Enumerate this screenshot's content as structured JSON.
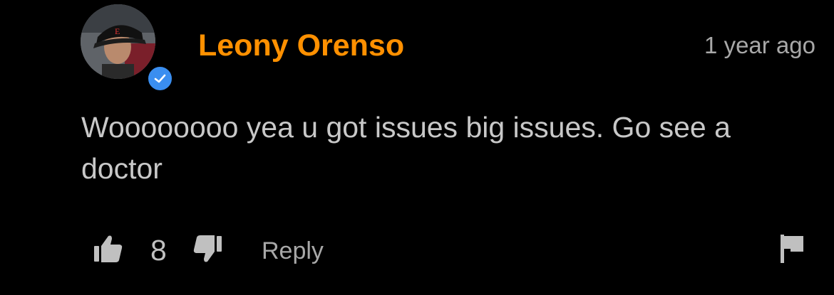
{
  "comment": {
    "author": "Leony Orenso",
    "timestamp": "1 year ago",
    "text": "Woooooooo yea u got issues big issues. Go see a doctor",
    "verified": true,
    "likes": "8",
    "reply_label": "Reply",
    "icons": {
      "avatar": "user-avatar",
      "verified": "verified-check-icon",
      "like": "thumbs-up-icon",
      "dislike": "thumbs-down-icon",
      "report": "flag-icon"
    }
  },
  "colors": {
    "background": "#000000",
    "author": "#ff9000",
    "text": "#c8c8c8",
    "muted": "#a8a8a8",
    "verified_badge": "#3a8ef0"
  }
}
